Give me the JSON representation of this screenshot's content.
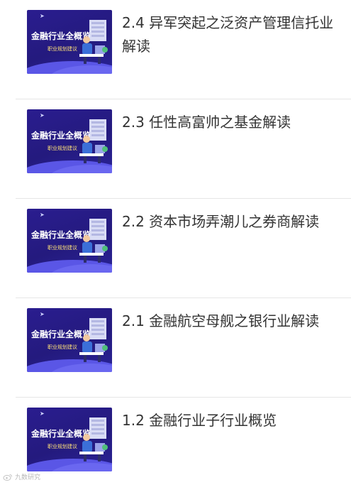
{
  "thumbnail": {
    "title": "金融行业全概览",
    "subtitle": "职业规划建议",
    "icon": "cursor-arrow-icon"
  },
  "items": [
    {
      "title": "2.4 异军突起之泛资产管理信托业解读"
    },
    {
      "title": "2.3 任性高富帅之基金解读"
    },
    {
      "title": "2.2 资本市场弄潮儿之券商解读"
    },
    {
      "title": "2.1 金融航空母舰之银行业解读"
    },
    {
      "title": "1.2 金融行业子行业概览"
    }
  ],
  "watermark": {
    "text": "九数研究",
    "icon": "weibo-icon"
  },
  "colors": {
    "thumb_bg": "#261b86",
    "thumb_wave": "#5a56e6",
    "title_text": "#333333",
    "divider": "#e6e6e6"
  }
}
